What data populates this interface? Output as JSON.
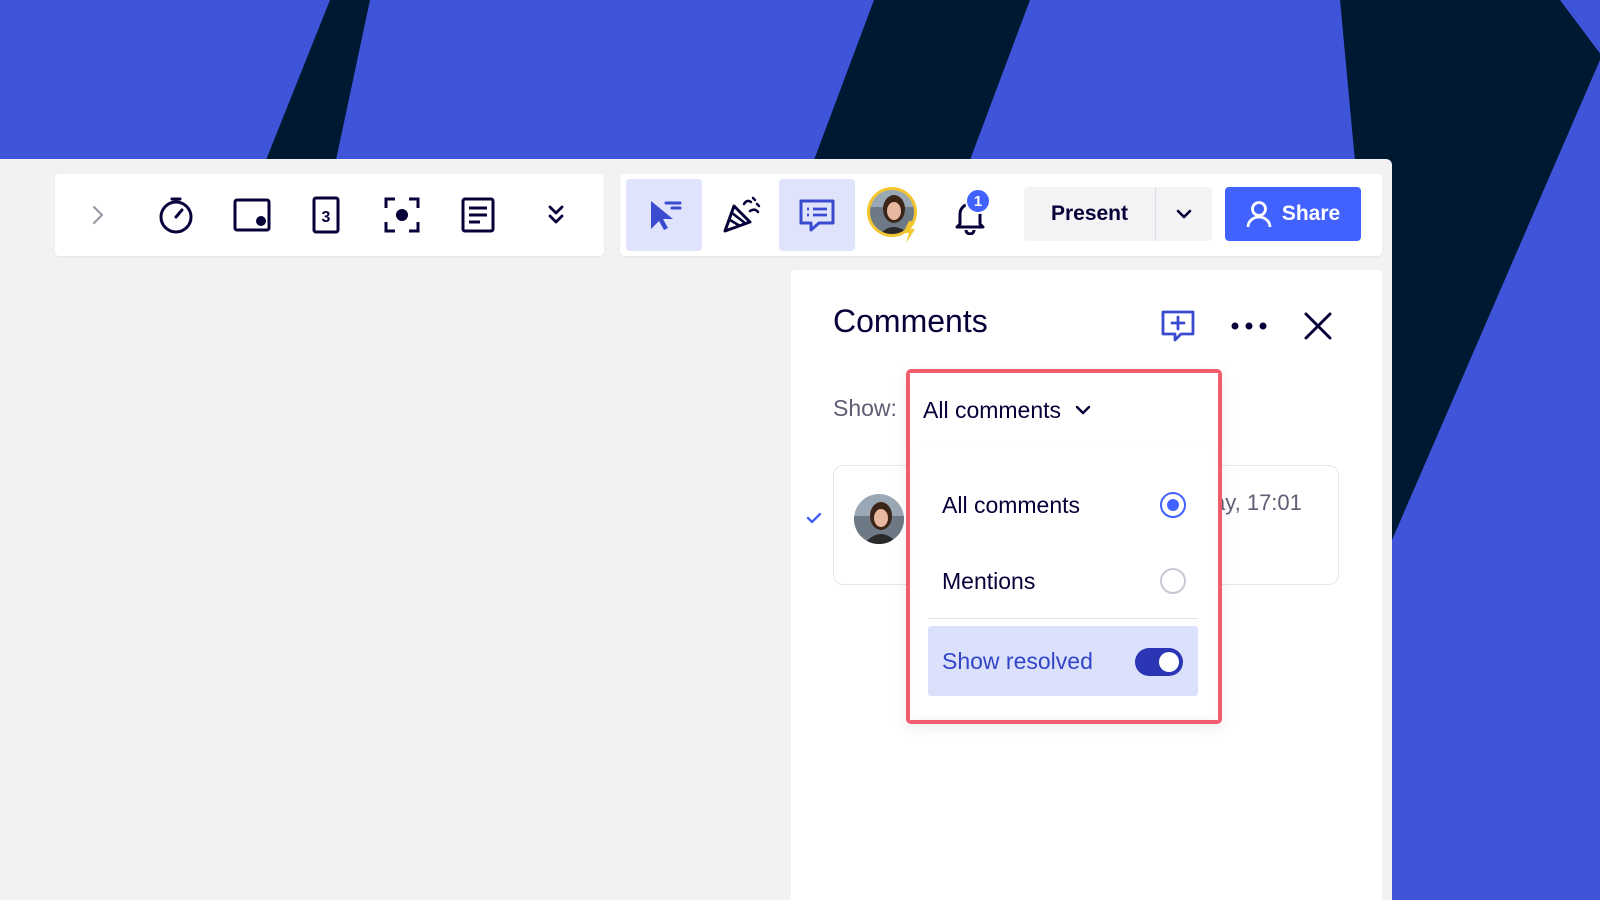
{
  "colors": {
    "background_blue": "#3f55d9",
    "background_navy": "#001933",
    "accent": "#4262ff",
    "highlight_border": "#f25d6e",
    "toggle_on": "#2c36b5"
  },
  "toolbar_left": {
    "icons": [
      "chevron-right-icon",
      "timer-icon",
      "frame-icon",
      "card-icon",
      "focus-icon",
      "notes-icon",
      "expand-more-icon"
    ]
  },
  "toolbar_right": {
    "icons": [
      "select-cursor-icon",
      "celebrate-icon",
      "comments-icon",
      "collaborator-avatar",
      "bell-icon"
    ],
    "notification_count": "1",
    "present_label": "Present",
    "share_label": "Share"
  },
  "comments_panel": {
    "title": "Comments",
    "show_label": "Show:",
    "filter_value": "All comments",
    "comment": {
      "time": "ay, 17:01"
    }
  },
  "filter_menu": {
    "options": [
      {
        "label": "All comments",
        "selected": true
      },
      {
        "label": "Mentions",
        "selected": false
      }
    ],
    "show_resolved_label": "Show resolved",
    "show_resolved_on": true
  }
}
